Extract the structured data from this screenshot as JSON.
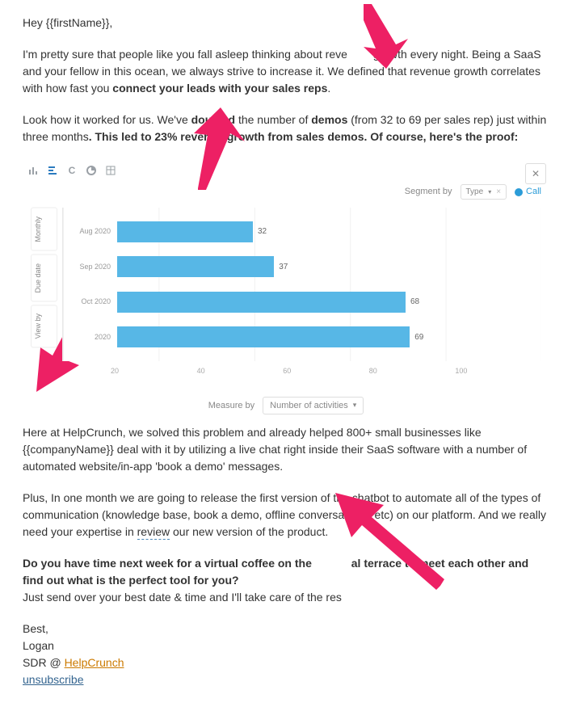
{
  "greeting": "Hey {{firstName}},",
  "p1_a": "I'm pretty sure that people like you fall asleep thinking about reve",
  "p1_b": " growth every night. Being a SaaS and your fellow in this ocean, we always strive to increase it. We defined that revenue growth correlates with how fast you ",
  "p1_bold": "connect your leads with your sales reps",
  "p1_c": ".",
  "p2_a": "Look how it worked for us. We've ",
  "p2_b": "doubled",
  "p2_c": " the number of ",
  "p2_d": "demos",
  "p2_e": " (from 32 to 69 per sales rep) just within three months",
  "p2_f": ". This led to 23% revenue growth from sales demos. Of course, here's the proof:",
  "chart": {
    "top_controls": {
      "segment_by_label": "Segment by",
      "segment_by_value": "Type",
      "call_label": "Call"
    },
    "side_labels": [
      "Monthly",
      "Due date",
      "View by"
    ],
    "measure_label": "Measure by",
    "measure_value": "Number of activities"
  },
  "chart_data": {
    "type": "bar",
    "orientation": "horizontal",
    "title": "",
    "xlabel": "",
    "ylabel": "",
    "xlim": [
      0,
      100
    ],
    "xticks": [
      20,
      40,
      60,
      80,
      100
    ],
    "categories": [
      "Aug 2020",
      "Sep 2020",
      "Oct 2020",
      "2020"
    ],
    "values": [
      32,
      37,
      68,
      69
    ]
  },
  "p3_a": "Here at HelpCrunch, we solved this problem and already helped 800+ small businesses like {{companyName}} deal with it by utilizing a live chat right inside their SaaS software with a number of automated website/in-app 'book a demo' messages.",
  "p4_a": "Plus, In one month we are going to release the first version of the chatbot to automate all of the types of communication (knowledge base, book a demo, offline conversations, etc) on our platform. And we really need your expertise in ",
  "p4_link": "review",
  "p4_b": " our new version of the product.",
  "p5_a": "Do you have time next week for a virtual coffee on the ",
  "p5_gap": "          ",
  "p5_b": "al terrace to meet each other and find out what is the perfect tool for you?",
  "p6": "Just send over your best date & time and I'll take care of the res",
  "signoff_best": "Best,",
  "signoff_name": "Logan",
  "signoff_role_a": "SDR @ ",
  "signoff_link": "HelpCrunch",
  "unsubscribe": "unsubscribe"
}
